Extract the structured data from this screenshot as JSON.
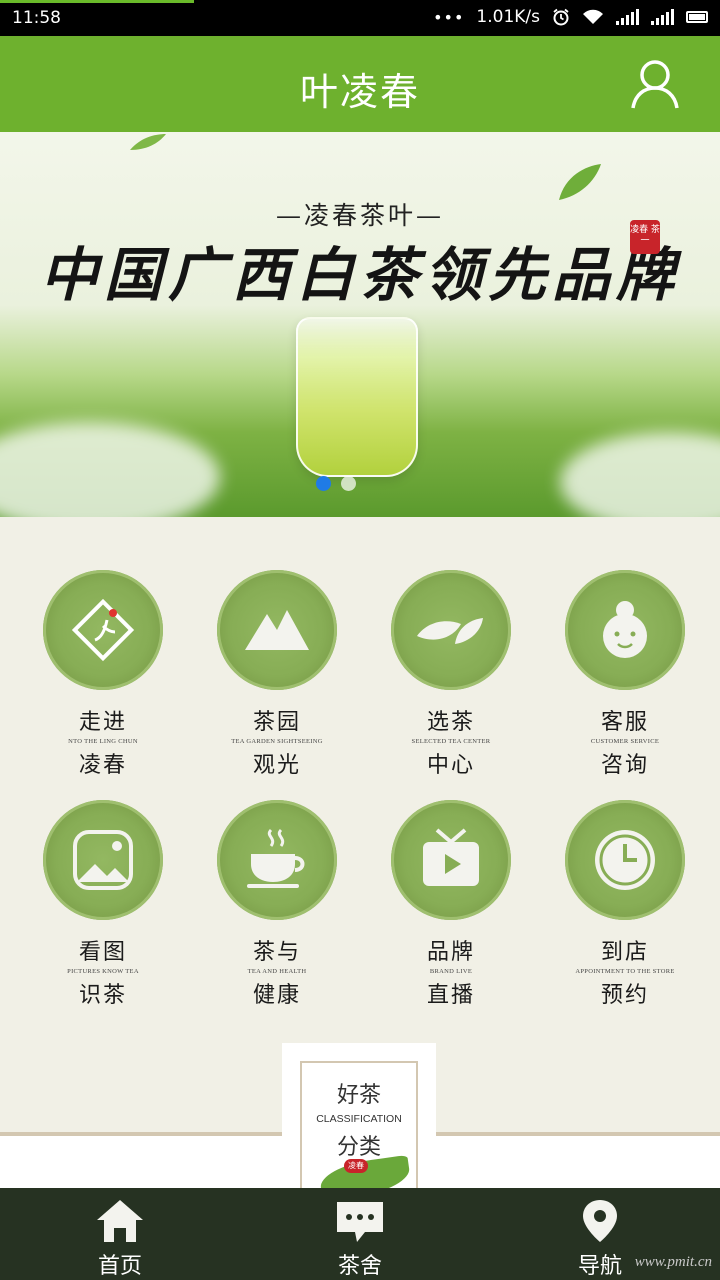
{
  "status_bar": {
    "time": "11:58",
    "network_speed": "1.01K/s"
  },
  "header": {
    "title": "叶凌春",
    "user_icon": "user-icon"
  },
  "banner": {
    "subtitle": "—凌春茶叶—",
    "headline": "中国广西白茶领先品牌",
    "seal_text": "凌春 茶一",
    "slide_count": 2,
    "active_slide": 1
  },
  "menu": {
    "items": [
      {
        "line1": "走进",
        "en": "NTO THE LING CHUN",
        "line2": "凌春",
        "icon": "brand-logo-icon"
      },
      {
        "line1": "茶园",
        "en": "TEA GARDEN SIGHTSEEING",
        "line2": "观光",
        "icon": "mountain-icon"
      },
      {
        "line1": "选茶",
        "en": "SELECTED TEA CENTER",
        "line2": "中心",
        "icon": "tea-leaf-icon"
      },
      {
        "line1": "客服",
        "en": "CUSTOMER SERVICE",
        "line2": "咨询",
        "icon": "service-person-icon"
      },
      {
        "line1": "看图",
        "en": "PICTURES KNOW TEA",
        "line2": "识茶",
        "icon": "picture-icon"
      },
      {
        "line1": "茶与",
        "en": "TEA AND HEALTH",
        "line2": "健康",
        "icon": "tea-cup-icon"
      },
      {
        "line1": "品牌",
        "en": "BRAND LIVE",
        "line2": "直播",
        "icon": "tv-play-icon"
      },
      {
        "line1": "到店",
        "en": "APPOINTMENT TO THE STORE",
        "line2": "预约",
        "icon": "clock-icon"
      }
    ]
  },
  "classification": {
    "title_top": "好茶",
    "english": "CLASSIFICATION",
    "title_bottom": "分类",
    "mark": "凌春"
  },
  "bottom_nav": {
    "items": [
      {
        "label": "首页",
        "icon": "home-icon"
      },
      {
        "label": "茶舍",
        "icon": "chat-icon"
      },
      {
        "label": "导航",
        "icon": "location-pin-icon"
      }
    ]
  },
  "watermark": "www.pmit.cn",
  "colors": {
    "header_green": "#6eb12e",
    "badge_green": "#87ad55",
    "nav_dark": "#263222",
    "active_dot": "#1f7be6"
  }
}
